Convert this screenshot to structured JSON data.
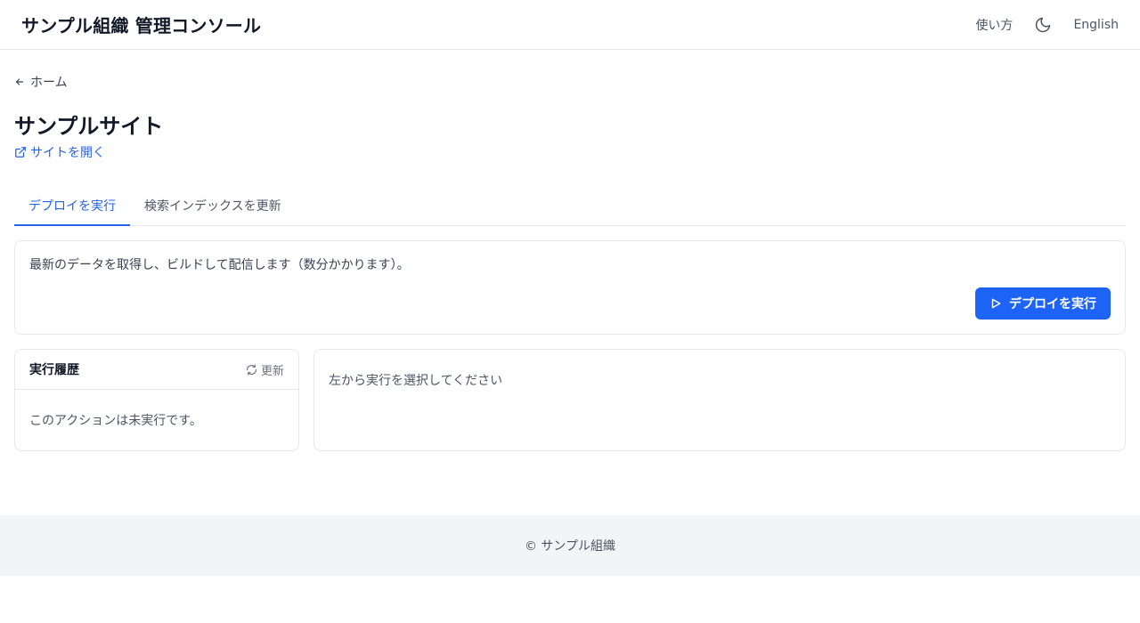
{
  "header": {
    "title": "サンプル組織 管理コンソール",
    "help_label": "使い方",
    "theme_icon": "moon-icon",
    "language_label": "English"
  },
  "nav": {
    "back_label": "ホーム",
    "back_icon": "arrow-left-icon"
  },
  "site": {
    "title": "サンプルサイト",
    "open_label": "サイトを開く",
    "open_icon": "external-link-icon"
  },
  "tabs": [
    {
      "label": "デプロイを実行",
      "active": true
    },
    {
      "label": "検索インデックスを更新",
      "active": false
    }
  ],
  "deploy": {
    "description": "最新のデータを取得し、ビルドして配信します（数分かかります）。",
    "button_label": "デプロイを実行",
    "button_icon": "play-icon"
  },
  "history": {
    "title": "実行履歴",
    "refresh_label": "更新",
    "refresh_icon": "refresh-icon",
    "empty_text": "このアクションは未実行です。"
  },
  "detail": {
    "placeholder": "左から実行を選択してください"
  },
  "footer": {
    "text": "© サンプル組織"
  },
  "colors": {
    "accent": "#2563eb",
    "button": "#1d63f5",
    "border": "#e5e7eb",
    "footer_bg": "#f3f4f6"
  }
}
